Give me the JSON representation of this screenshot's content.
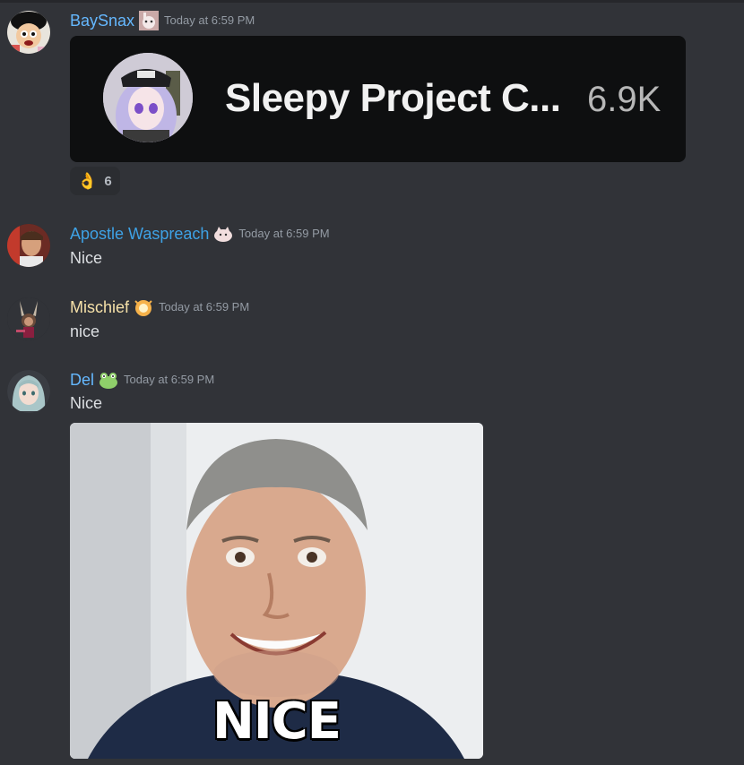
{
  "colors": {
    "background": "#313338",
    "username_blue": "#65b8ff",
    "username_yellow": "#f5e0a8",
    "timestamp": "#949ba4",
    "text": "#dbdee1"
  },
  "messages": [
    {
      "author": "BaySnax",
      "badge_icon": "bunny-avatar-badge-icon",
      "timestamp": "Today at 6:59 PM",
      "embed": {
        "title": "Sleepy Project C...",
        "count": "6.9K"
      },
      "reaction": {
        "emoji": "👌",
        "count": "6"
      }
    },
    {
      "author": "Apostle Waspreach",
      "badge_icon": "cloud-cat-badge-icon",
      "timestamp": "Today at 6:59 PM",
      "text": "Nice"
    },
    {
      "author": "Mischief",
      "badge_icon": "glowing-creature-badge-icon",
      "timestamp": "Today at 6:59 PM",
      "text": "nice"
    },
    {
      "author": "Del",
      "badge_icon": "frog-badge-icon",
      "timestamp": "Today at 6:59 PM",
      "text": "Nice",
      "gif_caption": "NICE"
    }
  ]
}
